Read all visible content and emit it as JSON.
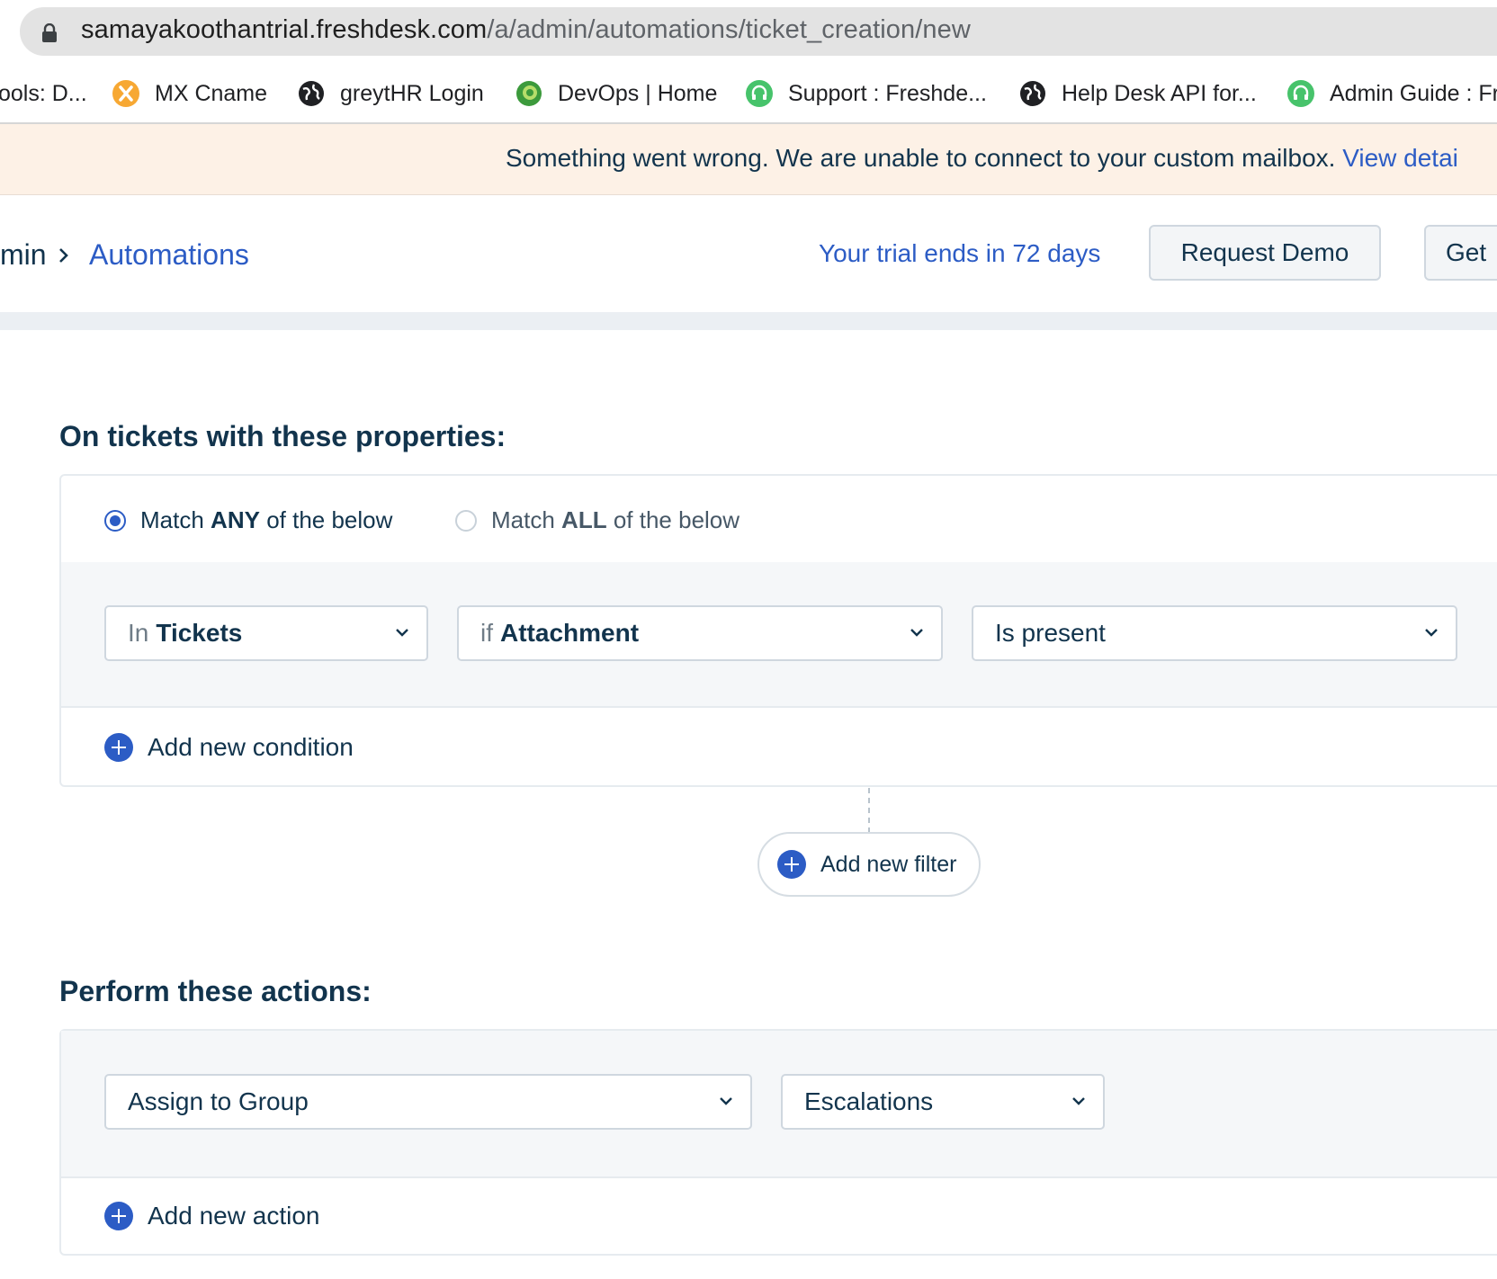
{
  "browser": {
    "url_host": "samayakoothantrial.freshdesk.com",
    "url_path": "/a/admin/automations/ticket_creation/new",
    "bookmarks": [
      {
        "label": "ools: D...",
        "icon": "none"
      },
      {
        "label": "MX Cname",
        "icon": "x-icon"
      },
      {
        "label": "greytHR Login",
        "icon": "globe-icon"
      },
      {
        "label": "DevOps | Home",
        "icon": "devops-icon"
      },
      {
        "label": "Support : Freshde...",
        "icon": "headset-icon"
      },
      {
        "label": "Help Desk API for...",
        "icon": "globe-icon"
      },
      {
        "label": "Admin Guide : Fr",
        "icon": "headset-icon"
      }
    ]
  },
  "alert": {
    "message": "Something went wrong. We are unable to connect to your custom mailbox.",
    "link": "View detai"
  },
  "header": {
    "breadcrumb_parent": "min",
    "breadcrumb_current": "Automations",
    "trial": "Your trial ends in 72 days",
    "request_demo": "Request Demo",
    "get_button": "Get"
  },
  "conditions": {
    "title": "On tickets with these properties:",
    "match_any": {
      "pre": "Match",
      "bold": "ANY",
      "post": "of the below",
      "selected": true
    },
    "match_all": {
      "pre": "Match",
      "bold": "ALL",
      "post": "of the below",
      "selected": false
    },
    "row": {
      "field1": {
        "prefix": "In",
        "value": "Tickets"
      },
      "field2": {
        "prefix": "if",
        "value": "Attachment"
      },
      "field3": {
        "value": "Is present"
      }
    },
    "add_condition": "Add new condition",
    "add_filter": "Add new filter"
  },
  "actions": {
    "title": "Perform these actions:",
    "row": {
      "action": "Assign to Group",
      "value": "Escalations"
    },
    "add_action": "Add new action"
  },
  "colors": {
    "accent": "#2c5cc5",
    "text": "#12344d",
    "alert_bg": "#fdf1e6"
  }
}
